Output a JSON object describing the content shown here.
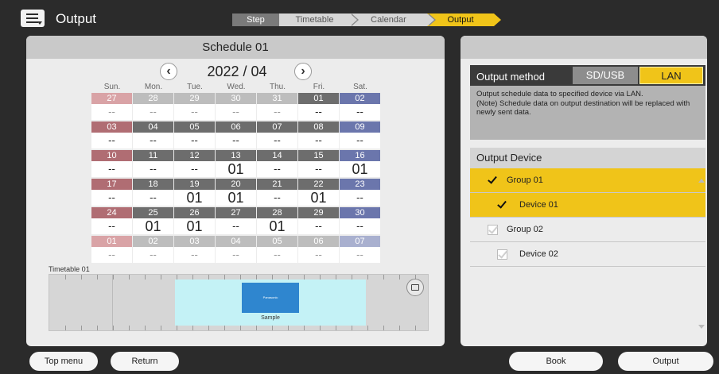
{
  "header": {
    "title": "Output",
    "steps_label": "Step",
    "steps": [
      {
        "label": "Timetable",
        "active": false
      },
      {
        "label": "Calendar",
        "active": false
      },
      {
        "label": "Output",
        "active": true
      }
    ]
  },
  "schedule": {
    "title": "Schedule 01",
    "month": "2022 / 04",
    "weekdays": [
      "Sun.",
      "Mon.",
      "Tue.",
      "Wed.",
      "Thu.",
      "Fri.",
      "Sat."
    ],
    "weeks": [
      [
        {
          "d": "27",
          "v": "--",
          "m": false
        },
        {
          "d": "28",
          "v": "--",
          "m": false
        },
        {
          "d": "29",
          "v": "--",
          "m": false
        },
        {
          "d": "30",
          "v": "--",
          "m": false
        },
        {
          "d": "31",
          "v": "--",
          "m": false
        },
        {
          "d": "01",
          "v": "--",
          "m": true
        },
        {
          "d": "02",
          "v": "--",
          "m": true
        }
      ],
      [
        {
          "d": "03",
          "v": "--",
          "m": true
        },
        {
          "d": "04",
          "v": "--",
          "m": true
        },
        {
          "d": "05",
          "v": "--",
          "m": true
        },
        {
          "d": "06",
          "v": "--",
          "m": true
        },
        {
          "d": "07",
          "v": "--",
          "m": true
        },
        {
          "d": "08",
          "v": "--",
          "m": true
        },
        {
          "d": "09",
          "v": "--",
          "m": true
        }
      ],
      [
        {
          "d": "10",
          "v": "--",
          "m": true
        },
        {
          "d": "11",
          "v": "--",
          "m": true
        },
        {
          "d": "12",
          "v": "--",
          "m": true
        },
        {
          "d": "13",
          "v": "01",
          "m": true
        },
        {
          "d": "14",
          "v": "--",
          "m": true
        },
        {
          "d": "15",
          "v": "--",
          "m": true
        },
        {
          "d": "16",
          "v": "01",
          "m": true
        }
      ],
      [
        {
          "d": "17",
          "v": "--",
          "m": true
        },
        {
          "d": "18",
          "v": "--",
          "m": true
        },
        {
          "d": "19",
          "v": "01",
          "m": true
        },
        {
          "d": "20",
          "v": "01",
          "m": true
        },
        {
          "d": "21",
          "v": "--",
          "m": true
        },
        {
          "d": "22",
          "v": "01",
          "m": true
        },
        {
          "d": "23",
          "v": "--",
          "m": true
        }
      ],
      [
        {
          "d": "24",
          "v": "--",
          "m": true
        },
        {
          "d": "25",
          "v": "01",
          "m": true
        },
        {
          "d": "26",
          "v": "01",
          "m": true
        },
        {
          "d": "27",
          "v": "--",
          "m": true
        },
        {
          "d": "28",
          "v": "01",
          "m": true
        },
        {
          "d": "29",
          "v": "--",
          "m": true
        },
        {
          "d": "30",
          "v": "--",
          "m": true
        }
      ],
      [
        {
          "d": "01",
          "v": "--",
          "m": false
        },
        {
          "d": "02",
          "v": "--",
          "m": false
        },
        {
          "d": "03",
          "v": "--",
          "m": false
        },
        {
          "d": "04",
          "v": "--",
          "m": false
        },
        {
          "d": "05",
          "v": "--",
          "m": false
        },
        {
          "d": "06",
          "v": "--",
          "m": false
        },
        {
          "d": "07",
          "v": "--",
          "m": false
        }
      ]
    ],
    "timetable_label": "Timetable 01",
    "sample_thumb_text": "Panasonic",
    "sample_label": "Sample"
  },
  "output": {
    "method_label": "Output method",
    "option_sd": "SD/USB",
    "option_lan": "LAN",
    "selected": "LAN",
    "description": "Output schedule data to specified device via LAN.\n(Note) Schedule data on output destination will be replaced with newly sent data.",
    "device_header": "Output Device",
    "devices": [
      {
        "label": "Group 01",
        "level": 0,
        "checked": true
      },
      {
        "label": "Device 01",
        "level": 1,
        "checked": true
      },
      {
        "label": "Group 02",
        "level": 0,
        "checked": false
      },
      {
        "label": "Device 02",
        "level": 1,
        "checked": false
      }
    ]
  },
  "footer": {
    "top_menu": "Top menu",
    "return": "Return",
    "book": "Book",
    "output": "Output"
  },
  "colors": {
    "accent": "#f0c419",
    "background": "#2b2b2b",
    "sunday": "#b06d73",
    "saturday": "#6b76ac",
    "weekday": "#6d6d6d"
  }
}
